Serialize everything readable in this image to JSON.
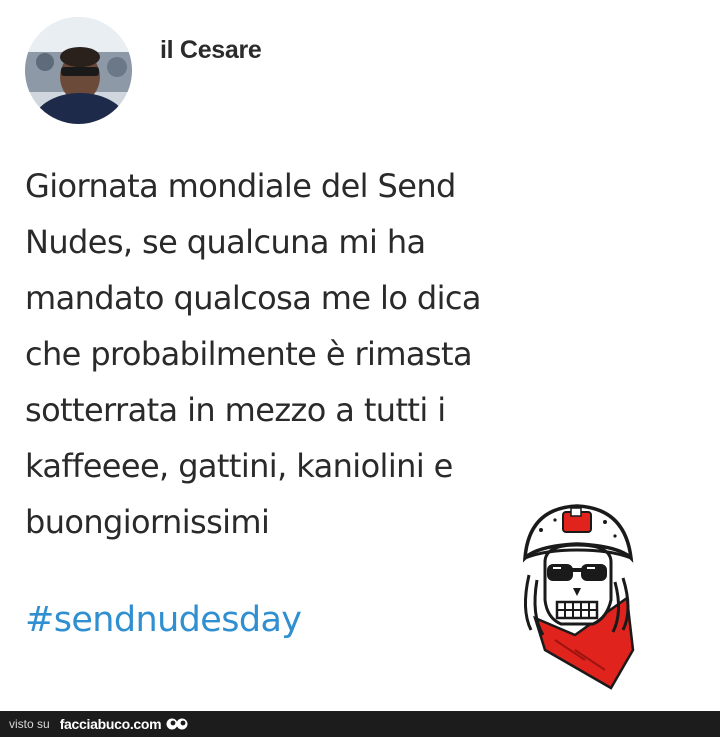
{
  "post": {
    "author": "il Cesare",
    "text": "Giornata mondiale del Send\nNudes, se qualcuna mi ha\nmandato qualcosa me lo dica\nche probabilmente è rimasta\nsotterrata in mezzo a tutti i\nkaffeeee, gattini, kaniolini e\nbuongiornissimi",
    "hashtag": "#sendnudesday"
  },
  "footer": {
    "prefix": "visto su",
    "site": "facciabuco.com"
  },
  "colors": {
    "hashtag": "#2f8fd0",
    "footer_bg": "#1c1c1c",
    "bandana": "#e0231c"
  },
  "icons": [
    "avatar-photo",
    "skull-helmet-sticker",
    "facciabuco-eyes-logo"
  ]
}
